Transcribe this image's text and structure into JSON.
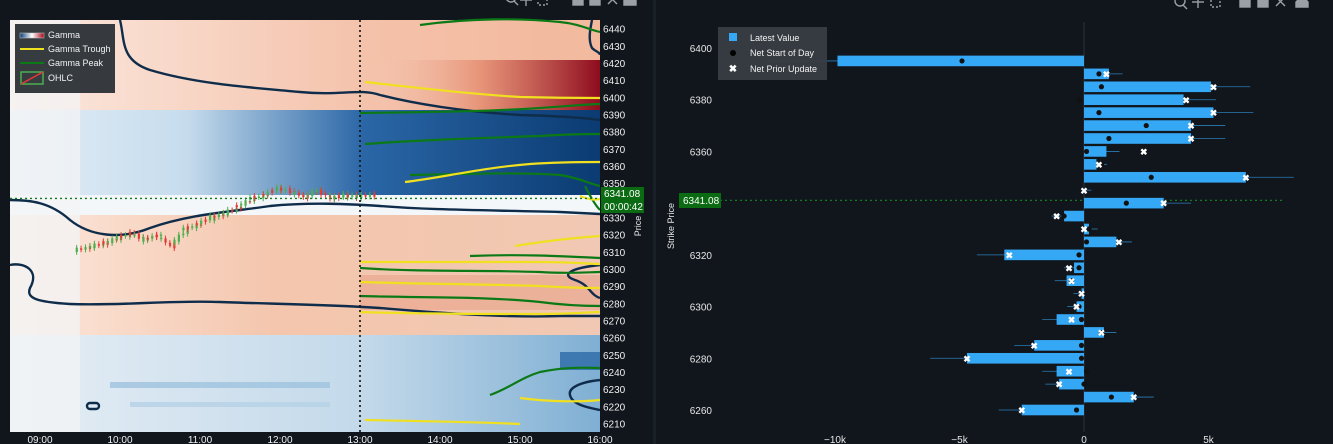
{
  "chart_data": [
    {
      "type": "heatmap",
      "name": "gamma-heatmap",
      "legend": {
        "placement": "top-left",
        "entries": [
          "Gamma",
          "Gamma Trough",
          "Gamma Peak",
          "OHLC"
        ]
      },
      "x_ticks": [
        "09:00",
        "10:00",
        "11:00",
        "12:00",
        "13:00",
        "14:00",
        "15:00",
        "16:00"
      ],
      "y_ticks": [
        6210,
        6220,
        6230,
        6240,
        6250,
        6260,
        6270,
        6280,
        6290,
        6300,
        6310,
        6320,
        6330,
        6340,
        6350,
        6360,
        6370,
        6380,
        6390,
        6400,
        6410,
        6420,
        6430,
        6440
      ],
      "ylim": [
        6205,
        6445
      ],
      "ylabel": "Price",
      "current_price_label": "6341.08",
      "countdown_label": "00:00:42",
      "current_price": 6341.08,
      "now_time": "13:00",
      "ohlc_close": [
        [
          "09:35",
          6313
        ],
        [
          "09:45",
          6315
        ],
        [
          "09:55",
          6318
        ],
        [
          "10:05",
          6321
        ],
        [
          "10:15",
          6317
        ],
        [
          "10:25",
          6320
        ],
        [
          "10:35",
          6313
        ],
        [
          "10:45",
          6323
        ],
        [
          "10:55",
          6326
        ],
        [
          "11:05",
          6330
        ],
        [
          "11:15",
          6332
        ],
        [
          "11:25",
          6336
        ],
        [
          "11:35",
          6341
        ],
        [
          "11:45",
          6343
        ],
        [
          "11:55",
          6347
        ],
        [
          "12:05",
          6345
        ],
        [
          "12:15",
          6342
        ],
        [
          "12:25",
          6346
        ],
        [
          "12:35",
          6341
        ],
        [
          "12:45",
          6343
        ],
        [
          "12:55",
          6342
        ],
        [
          "13:05",
          6343
        ]
      ]
    },
    {
      "type": "bar",
      "orientation": "horizontal",
      "name": "strike-gamma-bars",
      "ylabel": "Strike Price",
      "x_ticks": [
        "−10k",
        "−5k",
        "0",
        "5k"
      ],
      "xlim": [
        -11000,
        7700
      ],
      "y_ticks": [
        6260,
        6280,
        6300,
        6320,
        6340,
        6360,
        6380,
        6400
      ],
      "ylim": [
        6254,
        6415
      ],
      "current_price_label": "6341.08",
      "current_price": 6341.08,
      "legend": {
        "placement": "top-left",
        "entries": [
          "Latest Value",
          "Net Start of Day",
          "Net Prior Update"
        ]
      },
      "strikes": [
        6260,
        6265,
        6270,
        6275,
        6280,
        6285,
        6290,
        6295,
        6300,
        6305,
        6310,
        6315,
        6320,
        6325,
        6330,
        6335,
        6340,
        6345,
        6350,
        6355,
        6360,
        6365,
        6370,
        6375,
        6380,
        6385,
        6390,
        6395,
        6400
      ],
      "latest_value": [
        -2500,
        2000,
        -1000,
        -1100,
        -4700,
        -2000,
        800,
        -1100,
        -300,
        -100,
        -700,
        -400,
        -3200,
        1300,
        200,
        -800,
        3200,
        0,
        6500,
        500,
        900,
        4300,
        4300,
        5200,
        4000,
        5100,
        1000,
        -9900
      ],
      "net_start_of_day": [
        -300,
        1100,
        0,
        100,
        -100,
        -100,
        700,
        -100,
        -200,
        -100,
        -500,
        -200,
        -200,
        100,
        200,
        -800,
        1700,
        0,
        2700,
        700,
        100,
        1000,
        2500,
        600,
        -200,
        700,
        600,
        -4900
      ],
      "net_prior_update": [
        -2500,
        2000,
        -1000,
        -600,
        -4700,
        -2000,
        700,
        -500,
        -300,
        -100,
        -500,
        -600,
        -3000,
        1400,
        0,
        -1100,
        3200,
        0,
        6500,
        600,
        2400,
        4300,
        4300,
        5200,
        4100,
        5200,
        900,
        null
      ]
    }
  ]
}
